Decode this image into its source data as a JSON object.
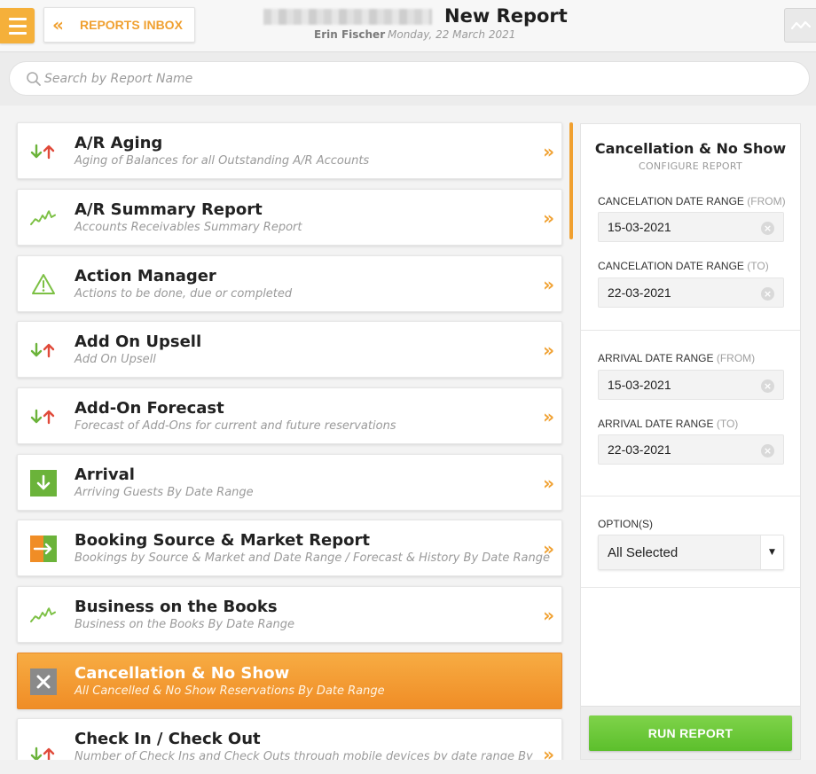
{
  "header": {
    "back_label": "REPORTS INBOX",
    "title": "New Report",
    "user": "Erin Fischer",
    "date": "Monday, 22 March 2021"
  },
  "search": {
    "placeholder": "Search by Report Name"
  },
  "reports": [
    {
      "title": "A/R Aging",
      "subtitle": "Aging of Balances for all Outstanding A/R Accounts",
      "icon": "up-down-arrows-icon",
      "active": false
    },
    {
      "title": "A/R Summary Report",
      "subtitle": "Accounts Receivables Summary Report",
      "icon": "trend-line-icon",
      "active": false
    },
    {
      "title": "Action Manager",
      "subtitle": "Actions to be done, due or completed",
      "icon": "warning-icon",
      "active": false
    },
    {
      "title": "Add On Upsell",
      "subtitle": "Add On Upsell",
      "icon": "up-down-arrows-icon",
      "active": false
    },
    {
      "title": "Add-On Forecast",
      "subtitle": "Forecast of Add-Ons for current and future reservations",
      "icon": "up-down-arrows-icon",
      "active": false
    },
    {
      "title": "Arrival",
      "subtitle": "Arriving Guests By Date Range",
      "icon": "arrival-icon",
      "active": false
    },
    {
      "title": "Booking Source & Market Report",
      "subtitle": "Bookings by Source & Market and Date Range / Forecast & History By Date Range",
      "icon": "booking-source-icon",
      "active": false
    },
    {
      "title": "Business on the Books",
      "subtitle": "Business on the Books By Date Range",
      "icon": "trend-line-icon",
      "active": false
    },
    {
      "title": "Cancellation & No Show",
      "subtitle": "All Cancelled & No Show Reservations By Date Range",
      "icon": "cancel-icon",
      "active": true
    },
    {
      "title": "Check In / Check Out",
      "subtitle": "Number of Check Ins and Check Outs through mobile devices by date range By",
      "icon": "up-down-arrows-icon",
      "active": false
    }
  ],
  "panel": {
    "title": "Cancellation & No Show",
    "subtitle": "CONFIGURE REPORT",
    "cancel_from_label": "CANCELATION DATE RANGE",
    "cancel_from_hint": "(FROM)",
    "cancel_from_value": "15-03-2021",
    "cancel_to_label": "CANCELATION DATE RANGE",
    "cancel_to_hint": "(TO)",
    "cancel_to_value": "22-03-2021",
    "arrival_from_label": "ARRIVAL DATE RANGE",
    "arrival_from_hint": "(FROM)",
    "arrival_from_value": "15-03-2021",
    "arrival_to_label": "ARRIVAL DATE RANGE",
    "arrival_to_hint": "(TO)",
    "arrival_to_value": "22-03-2021",
    "options_label": "OPTION(S)",
    "options_value": "All Selected",
    "run_label": "RUN REPORT"
  },
  "colors": {
    "accent": "#f0a030",
    "run_green": "#68c73a",
    "arrow_green": "#6bb33a",
    "arrow_red": "#e04a3a"
  }
}
